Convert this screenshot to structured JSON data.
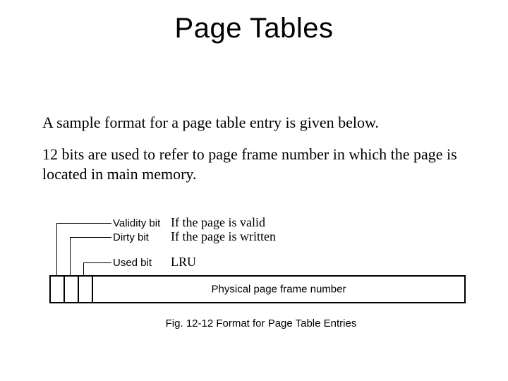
{
  "title": "Page Tables",
  "paragraphs": {
    "p1": "A sample format for a page table entry is given below.",
    "p2": "12 bits are used to refer to page frame number in which the page is located in main memory."
  },
  "bits": {
    "validity": {
      "label": "Validity bit",
      "note": "If the page is valid"
    },
    "dirty": {
      "label": "Dirty bit",
      "note": "If the page is written"
    },
    "used": {
      "label": "Used bit",
      "note": "LRU"
    }
  },
  "frame_label": "Physical page frame number",
  "caption": "Fig. 12-12  Format for Page Table Entries"
}
